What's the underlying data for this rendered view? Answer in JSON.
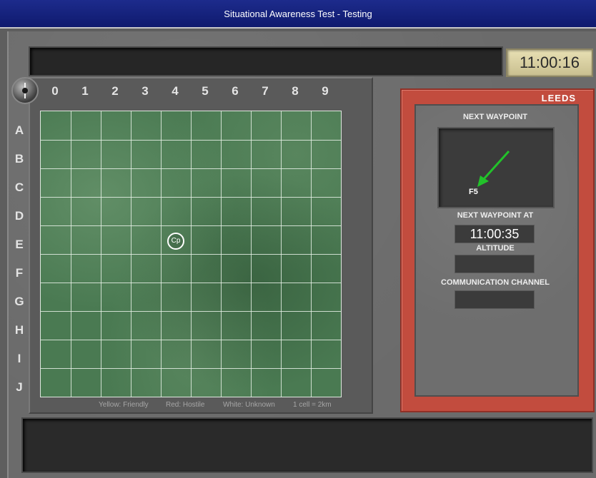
{
  "window": {
    "title": "Situational Awareness Test - Testing"
  },
  "clock": {
    "time": "11:00:16"
  },
  "map": {
    "columns": [
      "0",
      "1",
      "2",
      "3",
      "4",
      "5",
      "6",
      "7",
      "8",
      "9"
    ],
    "rows": [
      "A",
      "B",
      "C",
      "D",
      "E",
      "F",
      "G",
      "H",
      "I",
      "J"
    ],
    "marker": {
      "label": "Cp",
      "cell": "E4"
    },
    "legend": {
      "yellow": "Yellow: Friendly",
      "red": "Red: Hostile",
      "white": "White: Unknown",
      "scale": "1 cell = 2km"
    }
  },
  "side_panel": {
    "title": "LEEDS",
    "next_waypoint_label": "NEXT WAYPOINT",
    "waypoint_code": "F5",
    "next_waypoint_at_label": "NEXT WAYPOINT AT",
    "next_waypoint_at": "11:00:35",
    "altitude_label": "ALTITUDE",
    "altitude": "",
    "comm_channel_label": "COMMUNICATION CHANNEL",
    "comm_channel": ""
  },
  "colors": {
    "title_bar": "#1d2b8c",
    "panel_red": "#c24c3e",
    "map_green": "#4a7a52",
    "clock_bg": "#e8e0b4",
    "waypoint_arrow": "#22c22a"
  },
  "icons": {
    "compass": "compass-icon",
    "arrow": "waypoint-arrow-icon"
  }
}
